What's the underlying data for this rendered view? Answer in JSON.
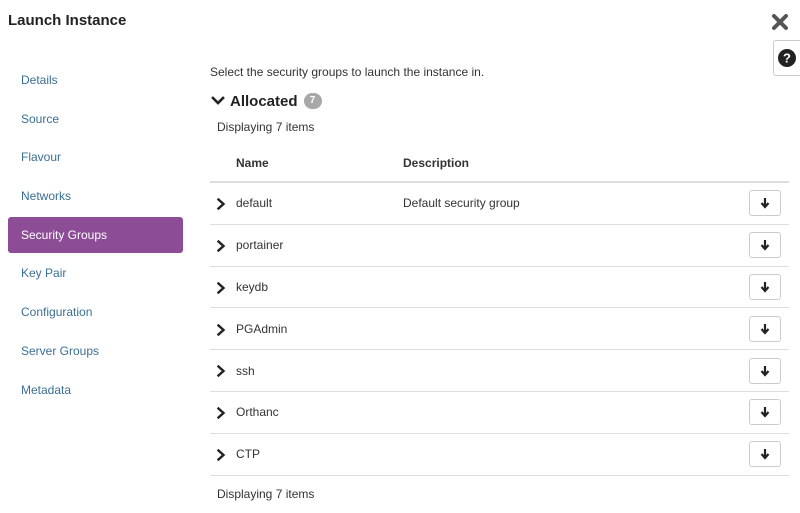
{
  "window": {
    "title": "Launch Instance"
  },
  "icons": {
    "close": "close-icon",
    "help": "question-circle-icon",
    "section_toggle": "chevron-down-icon",
    "row_expand": "chevron-right-icon",
    "row_action": "arrow-down-icon"
  },
  "colors": {
    "accent": "#8c4d96",
    "link": "#3a6f94",
    "badge": "#a8a8a8"
  },
  "nav": {
    "items": [
      {
        "label": "Details",
        "active": false
      },
      {
        "label": "Source",
        "active": false
      },
      {
        "label": "Flavour",
        "active": false
      },
      {
        "label": "Networks",
        "active": false
      },
      {
        "label": "Security Groups",
        "active": true
      },
      {
        "label": "Key Pair",
        "active": false
      },
      {
        "label": "Configuration",
        "active": false
      },
      {
        "label": "Server Groups",
        "active": false
      },
      {
        "label": "Metadata",
        "active": false
      }
    ]
  },
  "main": {
    "intro": "Select the security groups to launch the instance in.",
    "allocated": {
      "title": "Allocated",
      "count": "7",
      "displaying_top": "Displaying 7 items",
      "displaying_bottom": "Displaying 7 items",
      "columns": {
        "name": "Name",
        "description": "Description"
      },
      "rows": [
        {
          "name": "default",
          "description": "Default security group"
        },
        {
          "name": "portainer",
          "description": ""
        },
        {
          "name": "keydb",
          "description": ""
        },
        {
          "name": "PGAdmin",
          "description": ""
        },
        {
          "name": "ssh",
          "description": ""
        },
        {
          "name": "Orthanc",
          "description": ""
        },
        {
          "name": "CTP",
          "description": ""
        }
      ]
    }
  }
}
